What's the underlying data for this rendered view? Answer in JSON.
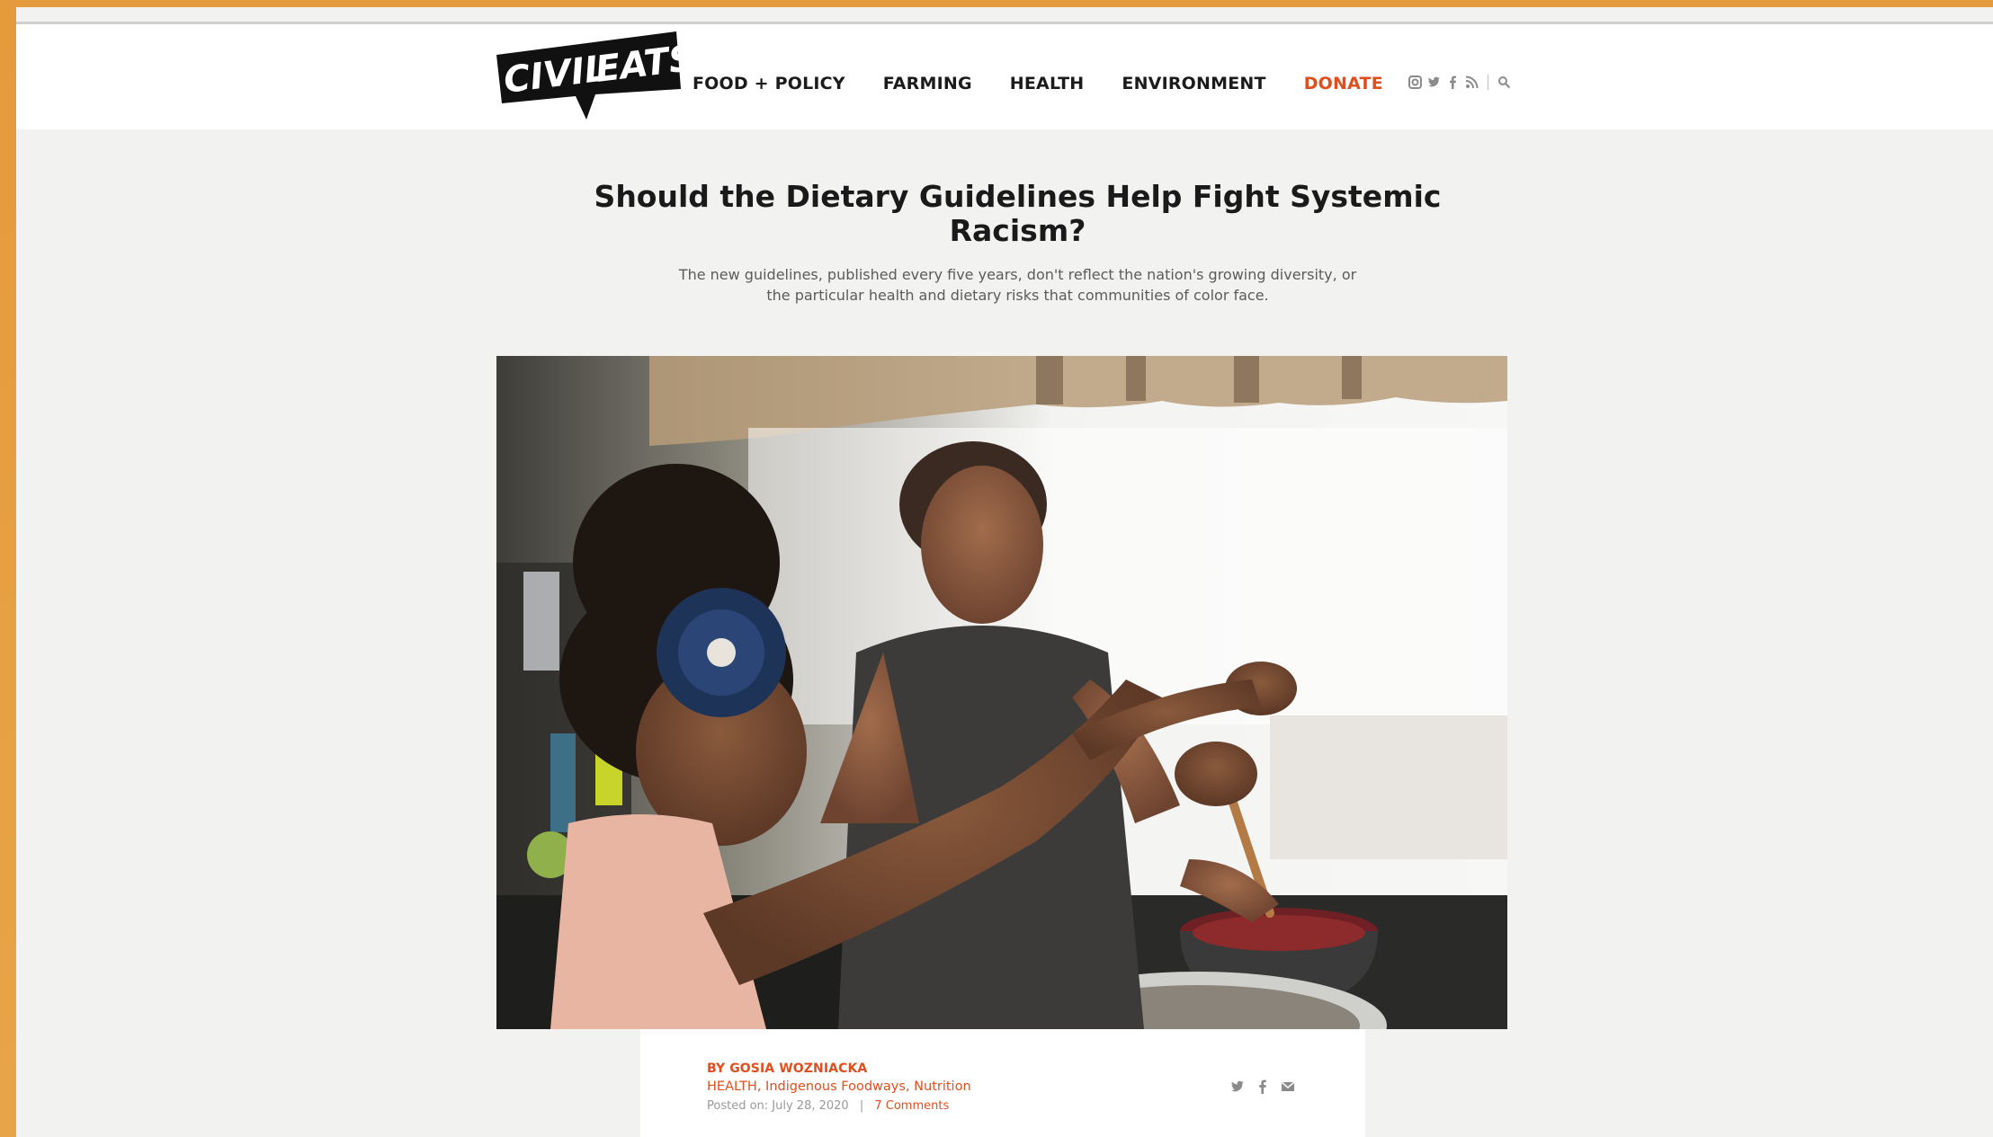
{
  "brand": {
    "logo_line1": "CIVIL",
    "logo_line2": "EATS"
  },
  "nav": {
    "items": [
      {
        "label": "FOOD + POLICY"
      },
      {
        "label": "FARMING"
      },
      {
        "label": "HEALTH"
      },
      {
        "label": "ENVIRONMENT"
      },
      {
        "label": "DONATE"
      }
    ]
  },
  "social_icons": [
    "instagram-icon",
    "twitter-icon",
    "facebook-icon",
    "rss-icon",
    "search-icon"
  ],
  "article": {
    "title": "Should the Dietary Guidelines Help Fight Systemic Racism?",
    "subtitle": "The new guidelines, published every five years, don't reflect the nation's growing diversity, or the particular health and dietary risks that communities of color face.",
    "byline": "BY GOSIA WOZNIACKA",
    "categories": [
      "HEALTH",
      "Indigenous Foodways",
      "Nutrition"
    ],
    "posted_label": "Posted on: July 28, 2020",
    "separator": "|",
    "comments": "7 Comments"
  },
  "share_icons": [
    "twitter-icon",
    "facebook-icon",
    "email-icon"
  ],
  "colors": {
    "accent": "#e14e1e",
    "frame": "#e59a3c",
    "page_bg": "#f2f2f0"
  }
}
